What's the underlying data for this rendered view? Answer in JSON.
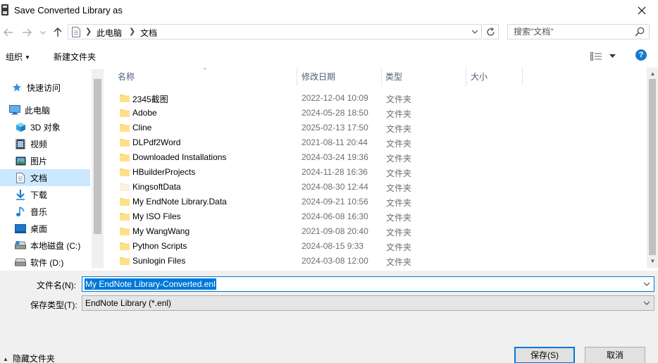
{
  "window": {
    "title": "Save Converted Library as"
  },
  "navigation": {
    "breadcrumbs": [
      "此电脑",
      "文档"
    ],
    "search_placeholder": "搜索\"文档\""
  },
  "toolbar": {
    "organize_label": "组织",
    "new_folder_label": "新建文件夹"
  },
  "nav_pane": {
    "items": [
      {
        "label": "快速访问",
        "icon": "star-icon"
      },
      {
        "label": "此电脑",
        "icon": "computer-icon"
      },
      {
        "label": "3D 对象",
        "icon": "cube-icon"
      },
      {
        "label": "视频",
        "icon": "video-icon"
      },
      {
        "label": "图片",
        "icon": "pictures-icon"
      },
      {
        "label": "文档",
        "icon": "documents-icon",
        "selected": true
      },
      {
        "label": "下载",
        "icon": "download-icon"
      },
      {
        "label": "音乐",
        "icon": "music-icon"
      },
      {
        "label": "桌面",
        "icon": "desktop-icon"
      },
      {
        "label": "本地磁盘 (C:)",
        "icon": "drive-icon"
      },
      {
        "label": "软件 (D:)",
        "icon": "drive-icon"
      }
    ]
  },
  "file_list": {
    "columns": [
      "名称",
      "修改日期",
      "类型",
      "大小"
    ],
    "rows": [
      {
        "name": "2345截图",
        "modified": "2022-12-04 10:09",
        "type": "文件夹"
      },
      {
        "name": "Adobe",
        "modified": "2024-05-28 18:50",
        "type": "文件夹"
      },
      {
        "name": "Cline",
        "modified": "2025-02-13 17:50",
        "type": "文件夹"
      },
      {
        "name": "DLPdf2Word",
        "modified": "2021-08-11 20:44",
        "type": "文件夹"
      },
      {
        "name": "Downloaded Installations",
        "modified": "2024-03-24 19:36",
        "type": "文件夹"
      },
      {
        "name": "HBuilderProjects",
        "modified": "2024-11-28 16:36",
        "type": "文件夹"
      },
      {
        "name": "KingsoftData",
        "modified": "2024-08-30 12:44",
        "type": "文件夹"
      },
      {
        "name": "My EndNote Library.Data",
        "modified": "2024-09-21 10:56",
        "type": "文件夹"
      },
      {
        "name": "My ISO Files",
        "modified": "2024-06-08 16:30",
        "type": "文件夹"
      },
      {
        "name": "My WangWang",
        "modified": "2021-09-08 20:40",
        "type": "文件夹"
      },
      {
        "name": "Python Scripts",
        "modified": "2024-08-15 9:33",
        "type": "文件夹"
      },
      {
        "name": "Sunlogin Files",
        "modified": "2024-03-08 12:00",
        "type": "文件夹"
      }
    ]
  },
  "footer": {
    "filename_label": "文件名(N):",
    "filename_value": "My EndNote Library-Converted.enl",
    "filetype_label": "保存类型(T):",
    "filetype_value": "EndNote Library (*.enl)",
    "hide_folders_label": "隐藏文件夹",
    "save_label": "保存(S)",
    "cancel_label": "取消"
  },
  "colors": {
    "accent": "#0078d7",
    "selection": "#cce8ff",
    "folder": "#f8d775"
  }
}
